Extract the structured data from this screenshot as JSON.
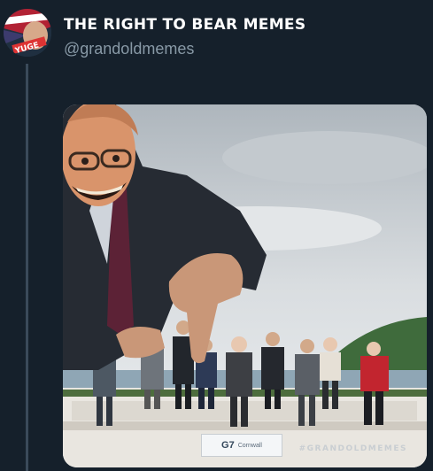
{
  "tweet": {
    "display_name": "THE RIGHT TO BEAR MEMES",
    "handle": "@grandoldmemes",
    "avatar_icon": "profile-avatar-icon"
  },
  "media": {
    "sign_text": "G7",
    "sign_subtext": "Cornwall",
    "watermark": "#GRANDOLDMEMES"
  },
  "colors": {
    "background": "#15202b",
    "name": "#ffffff",
    "handle": "#8899a6"
  }
}
